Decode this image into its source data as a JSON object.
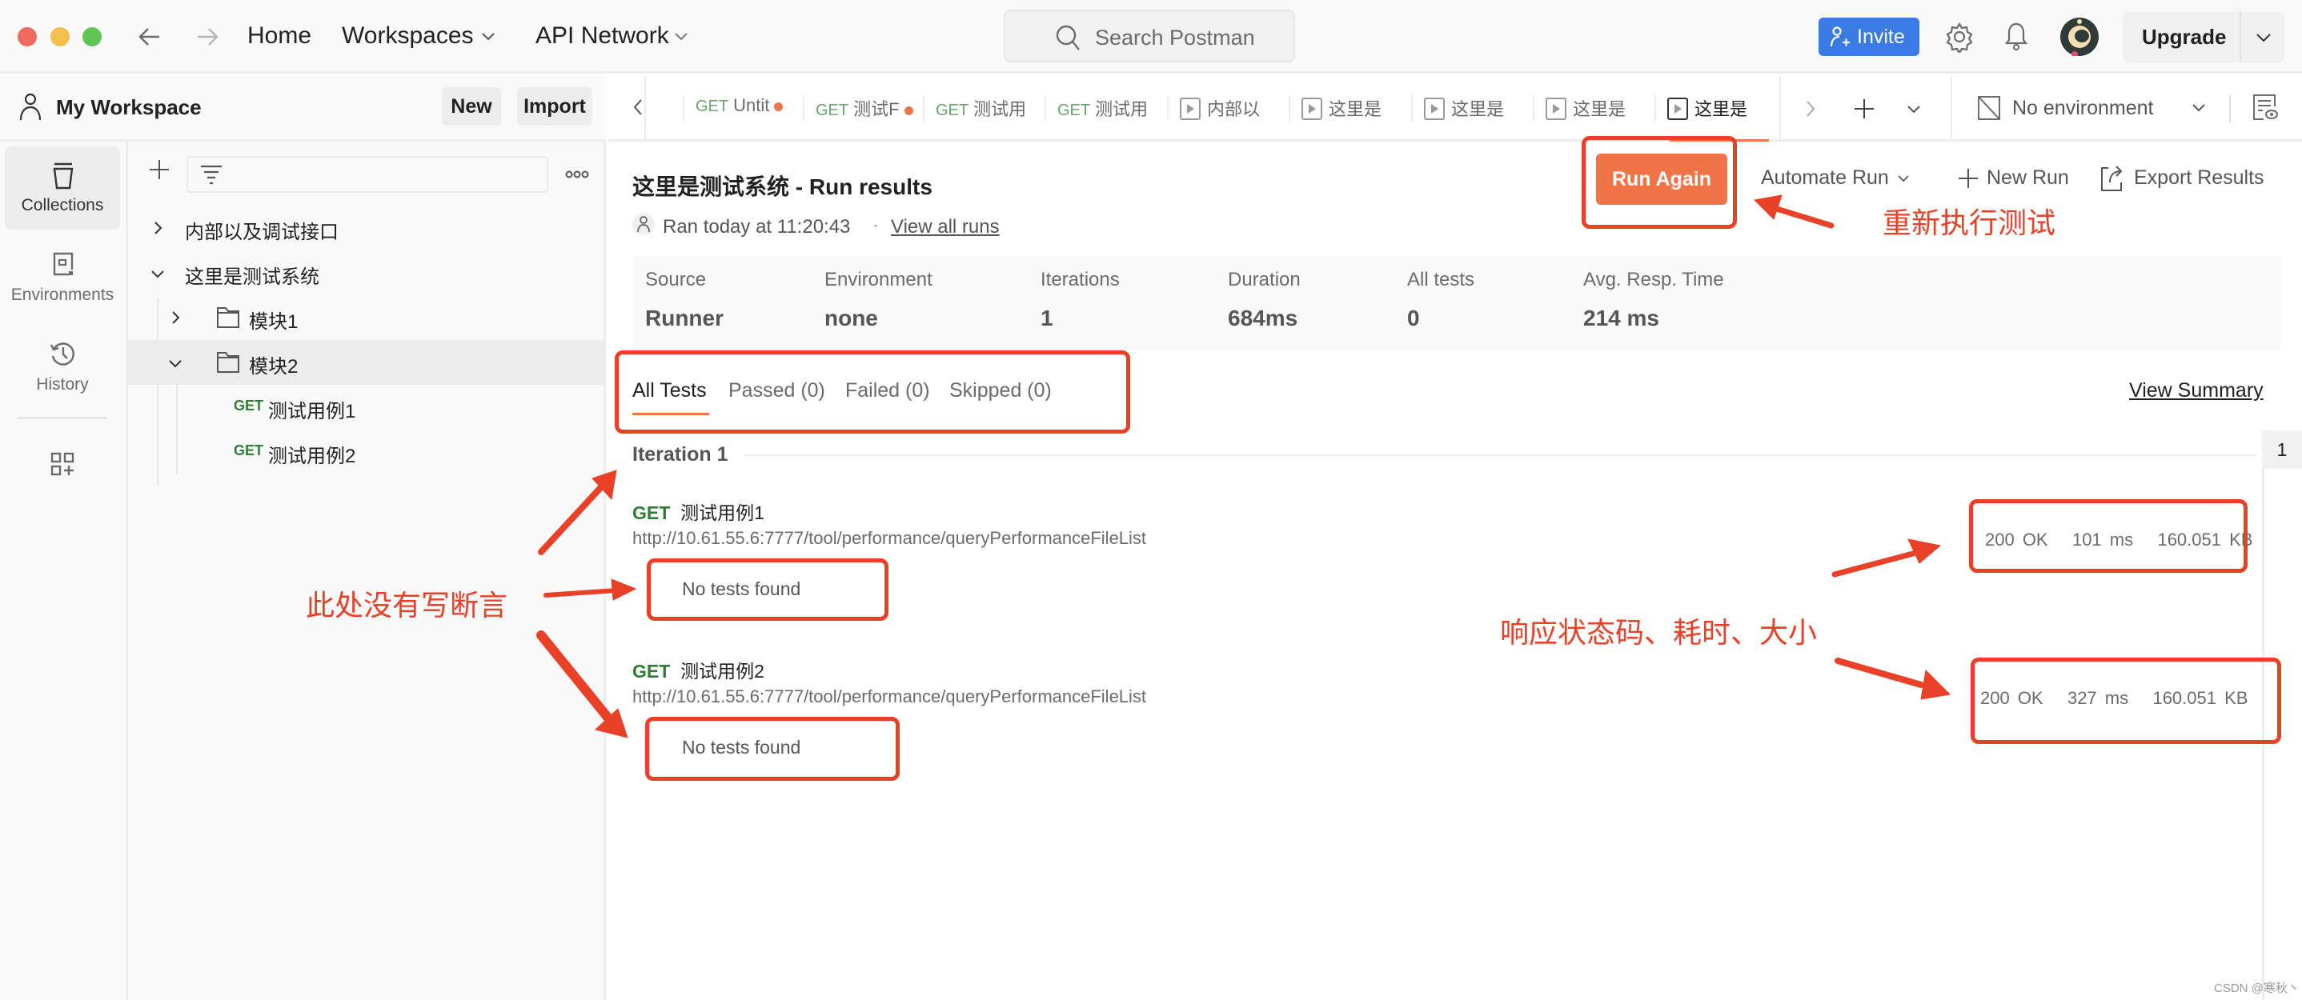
{
  "titlebar": {
    "home": "Home",
    "workspaces": "Workspaces",
    "api_network": "API Network",
    "search_placeholder": "Search Postman",
    "invite": "Invite",
    "upgrade": "Upgrade"
  },
  "workspace": {
    "name": "My Workspace",
    "new_label": "New",
    "import_label": "Import"
  },
  "rail": [
    {
      "label": "Collections",
      "icon": "collections-icon"
    },
    {
      "label": "Environments",
      "icon": "environments-icon"
    },
    {
      "label": "History",
      "icon": "history-icon"
    }
  ],
  "tree": {
    "collections": [
      {
        "name": "内部以及调试接口",
        "expanded": false
      },
      {
        "name": "这里是测试系统",
        "expanded": true
      }
    ],
    "folders": [
      {
        "name": "模块1",
        "expanded": false
      },
      {
        "name": "模块2",
        "expanded": true
      }
    ],
    "requests": [
      {
        "method": "GET",
        "name": "测试用例1"
      },
      {
        "method": "GET",
        "name": "测试用例2"
      }
    ]
  },
  "tabs": [
    {
      "method": "GET",
      "label": "Untit",
      "unsaved": true
    },
    {
      "method": "GET",
      "label": "测试F",
      "unsaved": true
    },
    {
      "method": "GET",
      "label": "测试用",
      "unsaved": false
    },
    {
      "method": "GET",
      "label": "测试用",
      "unsaved": false
    },
    {
      "type": "runner",
      "label": "内部以"
    },
    {
      "type": "runner",
      "label": "这里是"
    },
    {
      "type": "runner",
      "label": "这里是"
    },
    {
      "type": "runner",
      "label": "这里是"
    },
    {
      "type": "runner",
      "label": "这里是",
      "active": true
    }
  ],
  "environment": {
    "selected": "No environment"
  },
  "run": {
    "title": "这里是测试系统 - Run results",
    "ran_at": "Ran today at 11:20:43",
    "separator": "·",
    "view_all_runs": "View all runs",
    "run_again": "Run Again",
    "automate_run": "Automate Run",
    "new_run": "New Run",
    "export_results": "Export Results",
    "stats": [
      {
        "key": "Source",
        "value": "Runner"
      },
      {
        "key": "Environment",
        "value": "none"
      },
      {
        "key": "Iterations",
        "value": "1"
      },
      {
        "key": "Duration",
        "value": "684ms"
      },
      {
        "key": "All tests",
        "value": "0"
      },
      {
        "key": "Avg. Resp. Time",
        "value": "214 ms"
      }
    ],
    "filter_tabs": [
      {
        "label": "All Tests",
        "active": true
      },
      {
        "label": "Passed (0)"
      },
      {
        "label": "Failed (0)"
      },
      {
        "label": "Skipped (0)"
      }
    ],
    "view_summary": "View Summary",
    "iteration_label": "Iteration 1",
    "iteration_index": "1",
    "requests": [
      {
        "method": "GET",
        "name": "测试用例1",
        "url": "http://10.61.55.6:7777/tool/performance/queryPerformanceFileList",
        "tests": "No tests found",
        "status": "200 OK",
        "time": "101 ms",
        "size": "160.051 KB"
      },
      {
        "method": "GET",
        "name": "测试用例2",
        "url": "http://10.61.55.6:7777/tool/performance/queryPerformanceFileList",
        "tests": "No tests found",
        "status": "200 OK",
        "time": "327 ms",
        "size": "160.051 KB"
      }
    ]
  },
  "annotations": {
    "rerun": "重新执行测试",
    "no_assert": "此处没有写断言",
    "response_info": "响应状态码、耗时、大小"
  },
  "watermark": "CSDN @寒秋丶",
  "colors": {
    "accent": "#ef7548",
    "invite": "#3a7be3",
    "get": "#2f7d32",
    "annotation": "#e84127"
  }
}
